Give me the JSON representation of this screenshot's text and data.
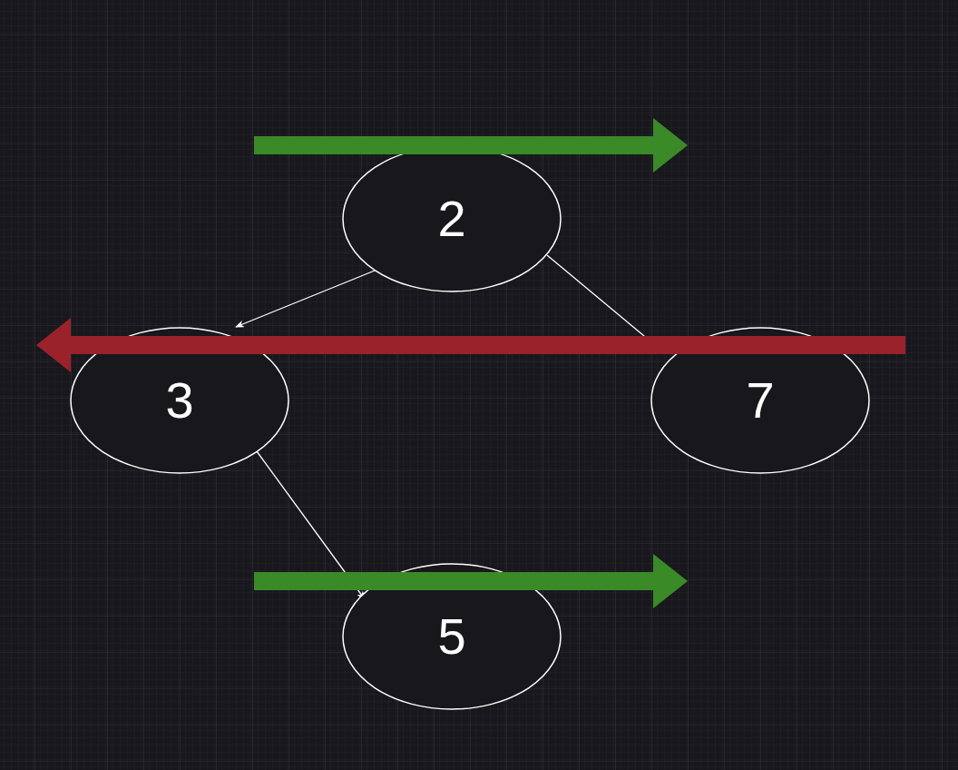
{
  "nodes": [
    {
      "label": "2"
    },
    {
      "label": "3"
    },
    {
      "label": "7"
    },
    {
      "label": "5"
    }
  ],
  "highlight_arrows": [
    {
      "kind": "right",
      "color": "#3a8a28"
    },
    {
      "kind": "left",
      "color": "#9a222b"
    },
    {
      "kind": "right",
      "color": "#3a8a28"
    }
  ]
}
